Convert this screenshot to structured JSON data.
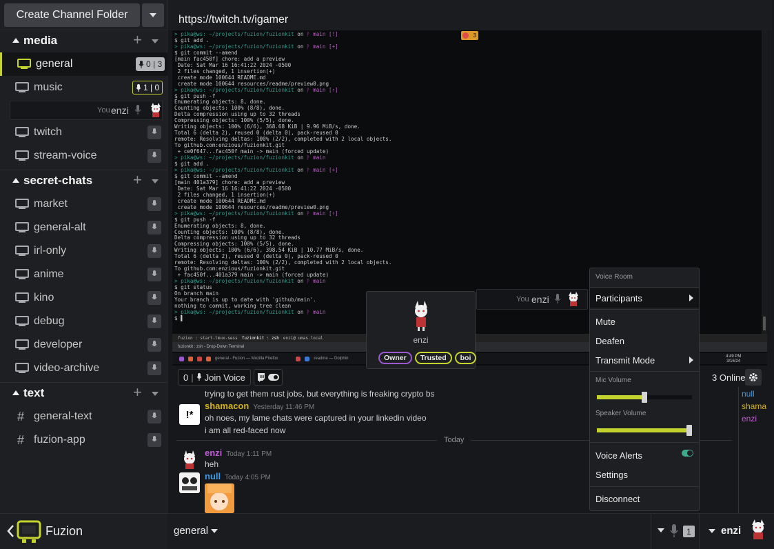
{
  "sidebar": {
    "create_folder_label": "Create Channel Folder",
    "groups": [
      {
        "name": "media"
      },
      {
        "name": "secret-chats"
      },
      {
        "name": "text"
      }
    ],
    "media_channels": [
      {
        "name": "general",
        "badge": "0 | 3"
      },
      {
        "name": "music",
        "badge": "1 | 0"
      }
    ],
    "voice_user": {
      "you": "You",
      "name": "enzi"
    },
    "media_more": [
      {
        "name": "twitch"
      },
      {
        "name": "stream-voice"
      }
    ],
    "secret_channels": [
      {
        "name": "market"
      },
      {
        "name": "general-alt"
      },
      {
        "name": "irl-only"
      },
      {
        "name": "anime"
      },
      {
        "name": "kino"
      },
      {
        "name": "debug"
      },
      {
        "name": "developer"
      },
      {
        "name": "video-archive"
      }
    ],
    "text_channels": [
      {
        "name": "general-text"
      },
      {
        "name": "fuzion-app"
      }
    ]
  },
  "app": {
    "name": "Fuzion"
  },
  "header": {
    "url": "https://twitch.tv/igamer"
  },
  "stream": {
    "badge_count": "3",
    "terminal_lines": [
      "> pika@ws: ~/projects/fuzion/fuzionkit on ᚹ main [!]",
      "$ git add .",
      "> pika@ws: ~/projects/fuzion/fuzionkit on ᚹ main [+]",
      "$ git commit --amend",
      "[main fac450f] chore: add a preview",
      " Date: Sat Mar 16 16:41:22 2024 -0500",
      " 2 files changed, 1 insertion(+)",
      " create mode 100644 README.md",
      " create mode 100644 resources/readme/preview0.png",
      "> pika@ws: ~/projects/fuzion/fuzionkit on ᚹ main [⇡]",
      "$ git push -f",
      "Enumerating objects: 8, done.",
      "Counting objects: 100% (8/8), done.",
      "Delta compression using up to 32 threads",
      "Compressing objects: 100% (5/5), done.",
      "Writing objects: 100% (6/6), 368.68 KiB | 9.96 MiB/s, done.",
      "Total 6 (delta 2), reused 0 (delta 0), pack-reused 0",
      "remote: Resolving deltas: 100% (2/2), completed with 2 local objects.",
      "To github.com:enzious/fuzionkit.git",
      " + ce0f647...fac450f main -> main (forced update)",
      "> pika@ws: ~/projects/fuzion/fuzionkit on ᚹ main",
      "$ git add .",
      "> pika@ws: ~/projects/fuzion/fuzionkit on ᚹ main [+]",
      "$ git commit --amend",
      "[main 401a379] chore: add a preview",
      " Date: Sat Mar 16 16:41:22 2024 -0500",
      " 2 files changed, 1 insertion(+)",
      " create mode 100644 README.md",
      " create mode 100644 resources/readme/preview0.png",
      "> pika@ws: ~/projects/fuzion/fuzionkit on ᚹ main [⇡]",
      "$ git push -f",
      "Enumerating objects: 8, done.",
      "Counting objects: 100% (8/8), done.",
      "Delta compression using up to 32 threads",
      "Compressing objects: 100% (5/5), done.",
      "Writing objects: 100% (6/6), 398.54 KiB | 10.77 MiB/s, done.",
      "Total 6 (delta 2), reused 0 (delta 0), pack-reused 0",
      "remote: Resolving deltas: 100% (2/2), completed with 2 local objects.",
      "To github.com:enzious/fuzionkit.git",
      " + fac450f...401a379 main -> main (forced update)",
      "> pika@ws: ~/projects/fuzion/fuzionkit on ᚹ main",
      "$ git status",
      "On branch main",
      "Your branch is up to date with 'github/main'.",
      "",
      "nothing to commit, working tree clean",
      "> pika@ws: ~/projects/fuzion/fuzionkit on ᚹ main",
      "$ ▌"
    ],
    "tmux_tabs": [
      "fuzion : start-tmux-sess",
      "fuzionkit : zsh",
      "enzi@ umas.local"
    ],
    "term_title": "fuzionkit : zsh - Drop-Down Terminal",
    "taskbar_items": [
      "general - Fuzion — Mozilla Firefox",
      "readme — Dolphin"
    ],
    "clock_time": "4:49 PM",
    "clock_date": "3/16/24"
  },
  "controls": {
    "viewers": "0",
    "join_voice": "Join Voice",
    "online": "3 Online"
  },
  "chat": {
    "line_top": "trying to get them rust jobs, but everything is freaking crypto bs",
    "shamacon": {
      "avatar": "!*",
      "name": "shamacon",
      "time": "Yesterday 11:46 PM",
      "lines": [
        "oh noes, my lame chats were captured in your linkedin video",
        "i am all red-faced now"
      ]
    },
    "divider": "Today",
    "enzi": {
      "name": "enzi",
      "time": "Today 1:11 PM",
      "text": "heh"
    },
    "null": {
      "name": "null",
      "time": "Today 4:05 PM"
    }
  },
  "members": [
    {
      "name": "null",
      "color": "#3d9be9"
    },
    {
      "name": "shamacon",
      "color": "#d4b21e"
    },
    {
      "name": "enzi",
      "color": "#c25ad8"
    }
  ],
  "card": {
    "name": "enzi",
    "roles": [
      "Owner",
      "Trusted",
      "boi"
    ]
  },
  "hover_row": {
    "you": "You",
    "name": "enzi"
  },
  "voice_menu": {
    "title": "Voice Room",
    "participants": "Participants",
    "mute": "Mute",
    "deafen": "Deafen",
    "transmit_mode": "Transmit Mode",
    "mic_volume_label": "Mic Volume",
    "mic_volume": 0.5,
    "speaker_volume_label": "Speaker Volume",
    "speaker_volume": 1.0,
    "voice_alerts": "Voice Alerts",
    "voice_alerts_on": true,
    "settings": "Settings",
    "disconnect": "Disconnect"
  },
  "bottom": {
    "channel": "general",
    "voice_count": "1",
    "user": "enzi"
  },
  "colors": {
    "accent": "#c4d32e",
    "purple": "#9b59d0"
  }
}
